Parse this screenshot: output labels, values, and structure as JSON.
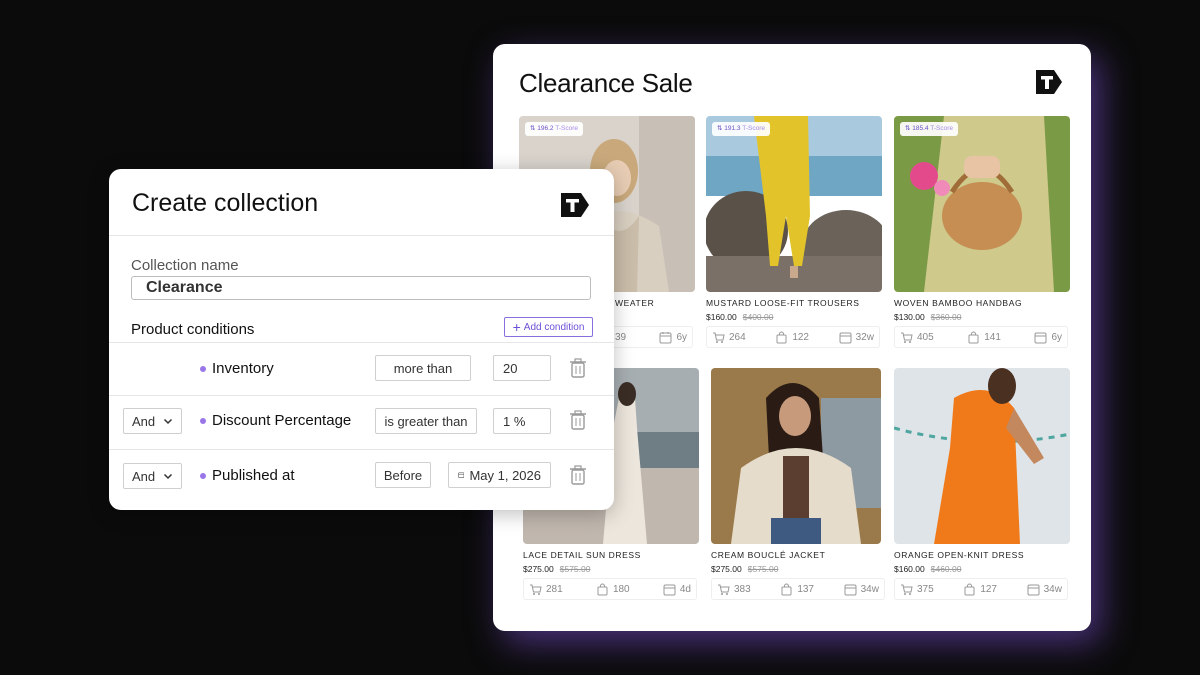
{
  "sale": {
    "title": "Clearance Sale",
    "logo_icon": "t-logo-icon",
    "products": [
      {
        "tscore": "196.2",
        "tscore_label": "T-Score",
        "name": "WEATER",
        "price": "",
        "old_price": "",
        "cart": "",
        "bag": "",
        "age": "39",
        "age2": "6y",
        "show_cart": false
      },
      {
        "tscore": "191.3",
        "tscore_label": "T-Score",
        "name": "MUSTARD LOOSE-FIT TROUSERS",
        "price": "$160.00",
        "old_price": "$400.00",
        "cart": "264",
        "bag": "122",
        "age2": "32w"
      },
      {
        "tscore": "185.4",
        "tscore_label": "T-Score",
        "name": "WOVEN BAMBOO HANDBAG",
        "price": "$130.00",
        "old_price": "$360.00",
        "cart": "405",
        "bag": "141",
        "age2": "6y"
      },
      {
        "name": "LACE DETAIL SUN DRESS",
        "price": "$275.00",
        "old_price": "$575.00",
        "cart": "281",
        "bag": "180",
        "age2": "4d"
      },
      {
        "name": "CREAM BOUCLÉ JACKET",
        "price": "$275.00",
        "old_price": "$575.00",
        "cart": "383",
        "bag": "137",
        "age2": "34w"
      },
      {
        "name": "ORANGE OPEN-KNIT DRESS",
        "price": "$160.00",
        "old_price": "$460.00",
        "cart": "375",
        "bag": "127",
        "age2": "34w"
      }
    ]
  },
  "create": {
    "title": "Create collection",
    "collection_name_label": "Collection name",
    "collection_name_value": "Clearance",
    "product_conditions_label": "Product conditions",
    "add_condition_label": "Add condition",
    "conditions": [
      {
        "connector": "",
        "field": "Inventory",
        "operator": "more than",
        "value": "20"
      },
      {
        "connector": "And",
        "field": "Discount Percentage",
        "operator": "is greater than",
        "value": "1 %"
      },
      {
        "connector": "And",
        "field": "Published at",
        "operator": "Before",
        "value": "May 1, 2026"
      }
    ]
  },
  "colors": {
    "accent": "#7c52d6",
    "background": "#0b0b0b"
  }
}
